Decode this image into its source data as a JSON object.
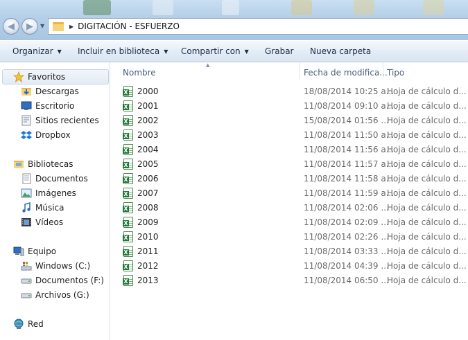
{
  "address": {
    "path": "DIGITACIÓN - ESFUERZO"
  },
  "toolbar": {
    "organize": "Organizar",
    "include_library": "Incluir en biblioteca",
    "share_with": "Compartir con",
    "burn": "Grabar",
    "new_folder": "Nueva carpeta"
  },
  "nav": {
    "favorites": "Favoritos",
    "downloads": "Descargas",
    "desktop": "Escritorio",
    "recent": "Sitios recientes",
    "dropbox": "Dropbox",
    "libraries": "Bibliotecas",
    "documents": "Documentos",
    "images": "Imágenes",
    "music": "Música",
    "videos": "Vídeos",
    "computer": "Equipo",
    "drive_c": "Windows (C:)",
    "drive_f": "Documentos (F:)",
    "drive_g": "Archivos (G:)",
    "network": "Red"
  },
  "columns": {
    "name": "Nombre",
    "date": "Fecha de modifica...",
    "type": "Tipo"
  },
  "files": [
    {
      "name": "2000",
      "date": "18/08/2014 10:25 a...",
      "type": "Hoja de cálculo d..."
    },
    {
      "name": "2001",
      "date": "11/08/2014 09:10 a...",
      "type": "Hoja de cálculo d..."
    },
    {
      "name": "2002",
      "date": "15/08/2014 01:56 ...",
      "type": "Hoja de cálculo d..."
    },
    {
      "name": "2003",
      "date": "11/08/2014 11:50 a...",
      "type": "Hoja de cálculo d..."
    },
    {
      "name": "2004",
      "date": "11/08/2014 11:56 a...",
      "type": "Hoja de cálculo d..."
    },
    {
      "name": "2005",
      "date": "11/08/2014 11:57 a...",
      "type": "Hoja de cálculo d..."
    },
    {
      "name": "2006",
      "date": "11/08/2014 11:58 a...",
      "type": "Hoja de cálculo d..."
    },
    {
      "name": "2007",
      "date": "11/08/2014 11:59 a...",
      "type": "Hoja de cálculo d..."
    },
    {
      "name": "2008",
      "date": "11/08/2014 02:06 ...",
      "type": "Hoja de cálculo d..."
    },
    {
      "name": "2009",
      "date": "11/08/2014 02:09 ...",
      "type": "Hoja de cálculo d..."
    },
    {
      "name": "2010",
      "date": "11/08/2014 02:26 ...",
      "type": "Hoja de cálculo d..."
    },
    {
      "name": "2011",
      "date": "11/08/2014 03:33 ...",
      "type": "Hoja de cálculo d..."
    },
    {
      "name": "2012",
      "date": "11/08/2014 04:39 ...",
      "type": "Hoja de cálculo d..."
    },
    {
      "name": "2013",
      "date": "11/08/2014 06:50 ...",
      "type": "Hoja de cálculo d..."
    }
  ]
}
